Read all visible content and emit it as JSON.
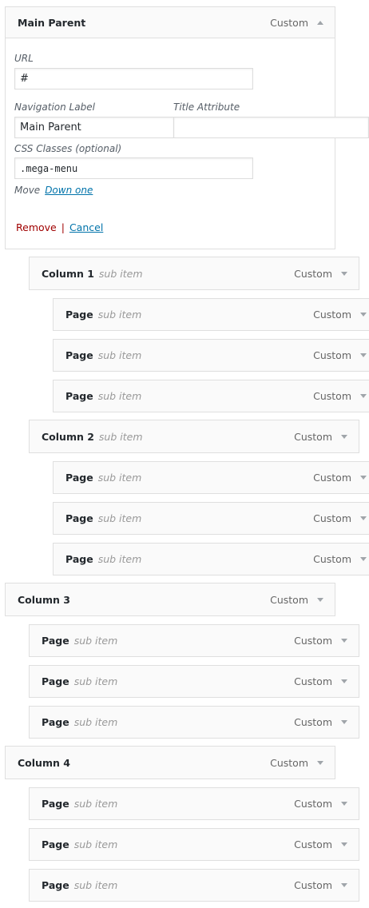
{
  "main_parent": {
    "title": "Main Parent",
    "type": "Custom"
  },
  "settings": {
    "url_label": "URL",
    "url_value": "#",
    "nav_label_label": "Navigation Label",
    "nav_label_value": "Main Parent",
    "title_attr_label": "Title Attribute",
    "title_attr_value": "",
    "css_label": "CSS Classes (optional)",
    "css_value": ".mega-menu",
    "move_label": "Move",
    "move_link": "Down one",
    "remove": "Remove",
    "separator": "|",
    "cancel": "Cancel"
  },
  "items": [
    {
      "title": "Column 1",
      "subtitle": "sub item",
      "type": "Custom"
    },
    {
      "title": "Page",
      "subtitle": "sub item",
      "type": "Custom"
    },
    {
      "title": "Page",
      "subtitle": "sub item",
      "type": "Custom"
    },
    {
      "title": "Page",
      "subtitle": "sub item",
      "type": "Custom"
    },
    {
      "title": "Column 2",
      "subtitle": "sub item",
      "type": "Custom"
    },
    {
      "title": "Page",
      "subtitle": "sub item",
      "type": "Custom"
    },
    {
      "title": "Page",
      "subtitle": "sub item",
      "type": "Custom"
    },
    {
      "title": "Page",
      "subtitle": "sub item",
      "type": "Custom"
    },
    {
      "title": "Column 3",
      "subtitle": "",
      "type": "Custom"
    },
    {
      "title": "Page",
      "subtitle": "sub item",
      "type": "Custom"
    },
    {
      "title": "Page",
      "subtitle": "sub item",
      "type": "Custom"
    },
    {
      "title": "Page",
      "subtitle": "sub item",
      "type": "Custom"
    },
    {
      "title": "Column 4",
      "subtitle": "",
      "type": "Custom"
    },
    {
      "title": "Page",
      "subtitle": "sub item",
      "type": "Custom"
    },
    {
      "title": "Page",
      "subtitle": "sub item",
      "type": "Custom"
    },
    {
      "title": "Page",
      "subtitle": "sub item",
      "type": "Custom"
    }
  ]
}
